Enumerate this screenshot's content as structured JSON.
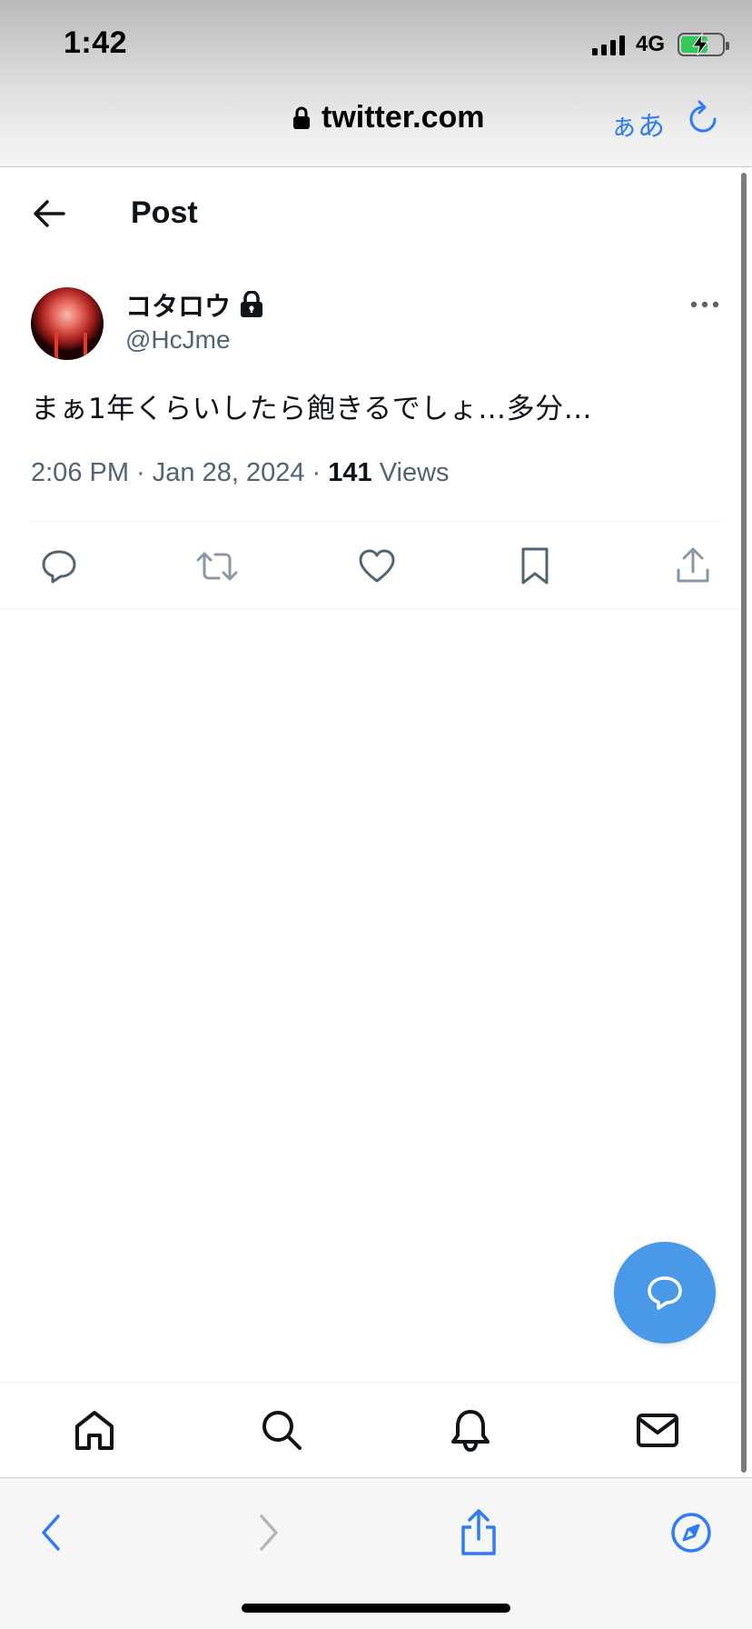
{
  "status_bar": {
    "time": "1:42",
    "network": "4G",
    "battery_level": 0.7
  },
  "browser": {
    "url": "twitter.com",
    "text_size_button": "ぁあ"
  },
  "header": {
    "title": "Post"
  },
  "post": {
    "author_name": "コタロウ",
    "handle": "@HcJme",
    "text": "まぁ1年くらいしたら飽きるでしょ…多分…",
    "timestamp": "2:06 PM · Jan 28, 2024 · ",
    "views_count": "141",
    "views_label": " Views"
  },
  "actions": [
    "reply-icon",
    "retweet-icon",
    "like-icon",
    "bookmark-icon",
    "share-icon"
  ],
  "nav": [
    "home-icon",
    "search-icon",
    "notifications-icon",
    "messages-icon"
  ],
  "colors": {
    "accent": "#1d9bf0",
    "fab": "#4a99e9",
    "safari_blue": "#2f7cf6",
    "secondary_text": "#536471",
    "battery_green": "#34c759"
  }
}
